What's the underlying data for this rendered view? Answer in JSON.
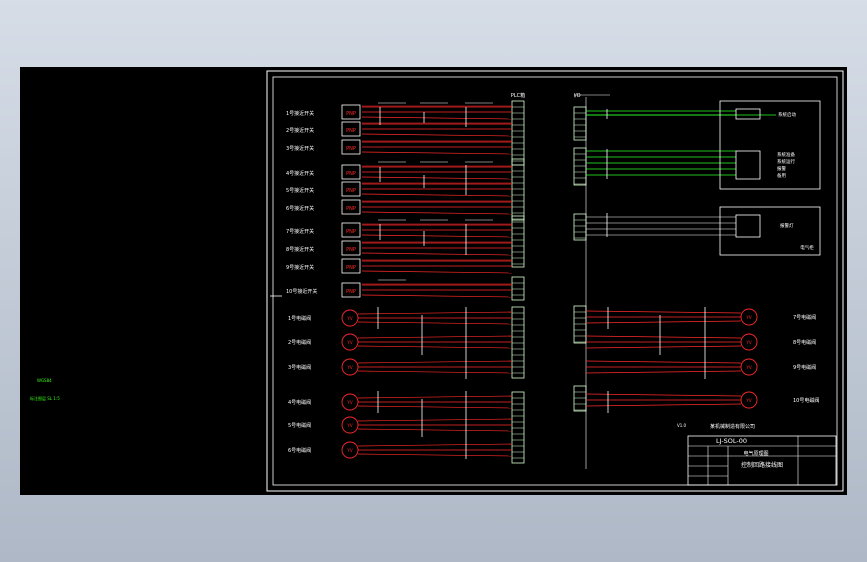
{
  "viewport": {
    "background": "#000000",
    "paper_color": "#e8ecf2"
  },
  "colors": {
    "frame": "#ffffff",
    "wire_red": "#ff2a2a",
    "wire_green": "#2dff2d",
    "text": "#ffffff",
    "terminal": "#d8ffd0",
    "marker": "#39ff14"
  },
  "plc": {
    "title": "PLC箱",
    "ports_per_group": 8
  },
  "io": {
    "title": "I/O"
  },
  "sensors": [
    {
      "label": "1号接近开关",
      "badge": "PNP"
    },
    {
      "label": "2号接近开关",
      "badge": "PNP"
    },
    {
      "label": "3号接近开关",
      "badge": "PNP"
    },
    {
      "label": "4号接近开关",
      "badge": "PNP"
    },
    {
      "label": "5号接近开关",
      "badge": "PNP"
    },
    {
      "label": "6号接近开关",
      "badge": "PNP"
    },
    {
      "label": "7号接近开关",
      "badge": "PNP"
    },
    {
      "label": "8号接近开关",
      "badge": "PNP"
    },
    {
      "label": "9号接近开关",
      "badge": "PNP"
    },
    {
      "label": "10号接近开关",
      "badge": "PNP"
    }
  ],
  "valves_left": [
    {
      "label": "1号电磁阀",
      "symbol": "YV"
    },
    {
      "label": "2号电磁阀",
      "symbol": "YV"
    },
    {
      "label": "3号电磁阀",
      "symbol": "YV"
    },
    {
      "label": "4号电磁阀",
      "symbol": "YV"
    },
    {
      "label": "5号电磁阀",
      "symbol": "YV"
    },
    {
      "label": "6号电磁阀",
      "symbol": "YV"
    }
  ],
  "valves_right": [
    {
      "label": "7号电磁阀",
      "symbol": "YV"
    },
    {
      "label": "8号电磁阀",
      "symbol": "YV"
    },
    {
      "label": "9号电磁阀",
      "symbol": "YV"
    },
    {
      "label": "10号电磁阀",
      "symbol": "YV"
    }
  ],
  "devices": {
    "top": "系统启动",
    "middle": [
      "系统准备",
      "系统运行",
      "报警",
      "备用"
    ],
    "bottom": "报警灯",
    "cabinet": "电气柜"
  },
  "green_notes": [
    "WGS84",
    "标注图层 SL 1:5"
  ],
  "title_block": {
    "company": "某机械制造有限公司",
    "drawing_no": "LJ-SOL-00",
    "name": "电气原理图",
    "title": "控制回路接线图",
    "version_mark": "V1.0"
  }
}
